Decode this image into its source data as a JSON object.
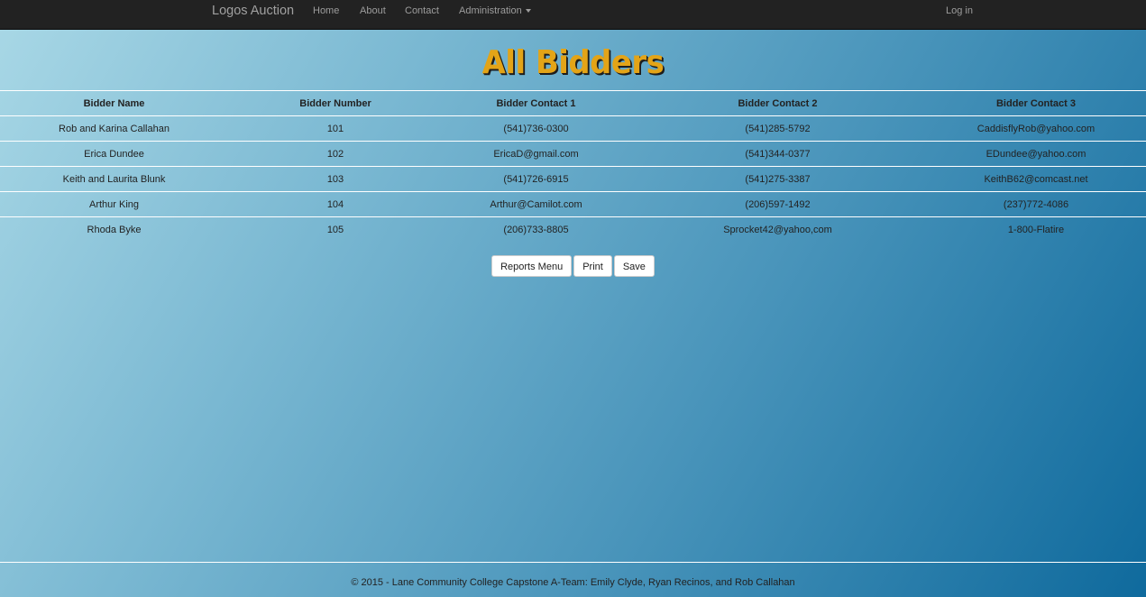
{
  "navbar": {
    "brand": "Logos Auction",
    "links": [
      {
        "label": "Home"
      },
      {
        "label": "About"
      },
      {
        "label": "Contact"
      },
      {
        "label": "Administration"
      }
    ],
    "login": "Log in"
  },
  "page": {
    "title": "All Bidders"
  },
  "table": {
    "headers": [
      "Bidder Name",
      "Bidder Number",
      "Bidder Contact 1",
      "Bidder Contact 2",
      "Bidder Contact 3"
    ],
    "rows": [
      [
        "Rob and Karina Callahan",
        "101",
        "(541)736-0300",
        "(541)285-5792",
        "CaddisflyRob@yahoo.com"
      ],
      [
        "Erica Dundee",
        "102",
        "EricaD@gmail.com",
        "(541)344-0377",
        "EDundee@yahoo.com"
      ],
      [
        "Keith and Laurita Blunk",
        "103",
        "(541)726-6915",
        "(541)275-3387",
        "KeithB62@comcast.net"
      ],
      [
        "Arthur King",
        "104",
        "Arthur@Camilot.com",
        "(206)597-1492",
        "(237)772-4086"
      ],
      [
        "Rhoda Byke",
        "105",
        "(206)733-8805",
        "Sprocket42@yahoo,com",
        "1-800-Flatire"
      ]
    ]
  },
  "buttons": {
    "reports_menu": "Reports Menu",
    "print": "Print",
    "save": "Save"
  },
  "footer": {
    "text": "© 2015 - Lane Community College Capstone A-Team: Emily Clyde, Ryan Recinos, and Rob Callahan"
  },
  "colors": {
    "navbar": "#222222",
    "title": "#e3a417",
    "gradient_start": "#a9d8e6",
    "gradient_end": "#0f6a9d"
  }
}
